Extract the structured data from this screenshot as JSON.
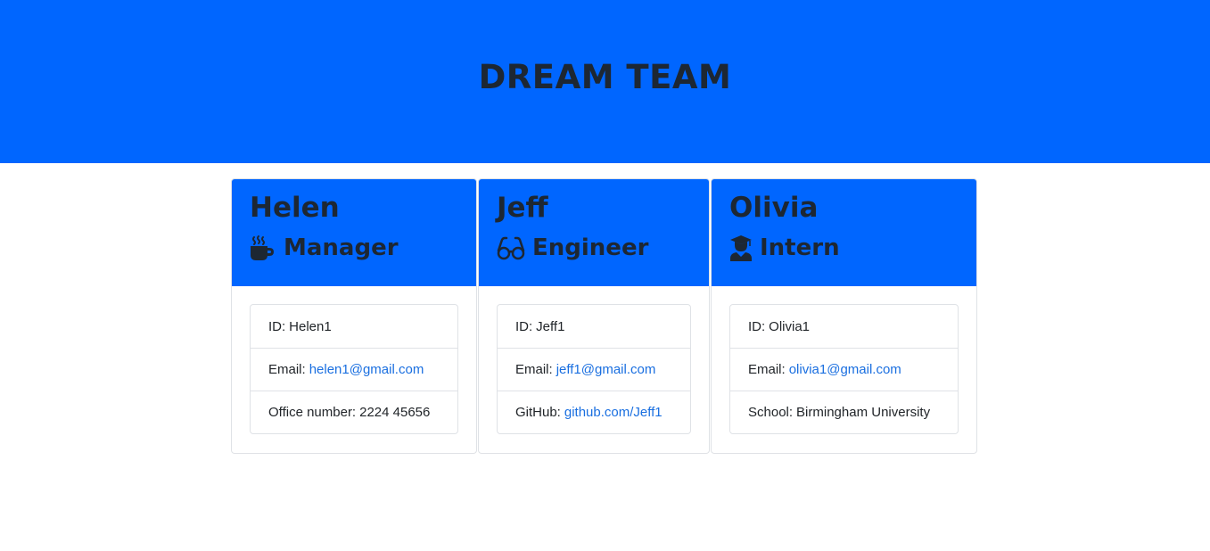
{
  "header": {
    "title": "DREAM TEAM",
    "background": "#0066ff"
  },
  "team": [
    {
      "name": "Helen",
      "role": "Manager",
      "role_icon": "coffee-mug-icon",
      "id_label": "ID:",
      "id": "Helen1",
      "email_label": "Email:",
      "email": "helen1@gmail.com",
      "extra_label": "Office number:",
      "extra_value": "2224 45656"
    },
    {
      "name": "Jeff",
      "role": "Engineer",
      "role_icon": "glasses-icon",
      "id_label": "ID:",
      "id": "Jeff1",
      "email_label": "Email:",
      "email": "jeff1@gmail.com",
      "extra_label": "GitHub:",
      "extra_value": "github.com/Jeff1"
    },
    {
      "name": "Olivia",
      "role": "Intern",
      "role_icon": "graduate-icon",
      "id_label": "ID:",
      "id": "Olivia1",
      "email_label": "Email:",
      "email": "olivia1@gmail.com",
      "extra_label": "School:",
      "extra_value": "Birmingham University"
    }
  ],
  "colors": {
    "accent": "#0066ff",
    "link": "#1a6fe0",
    "text": "#1d2733"
  }
}
